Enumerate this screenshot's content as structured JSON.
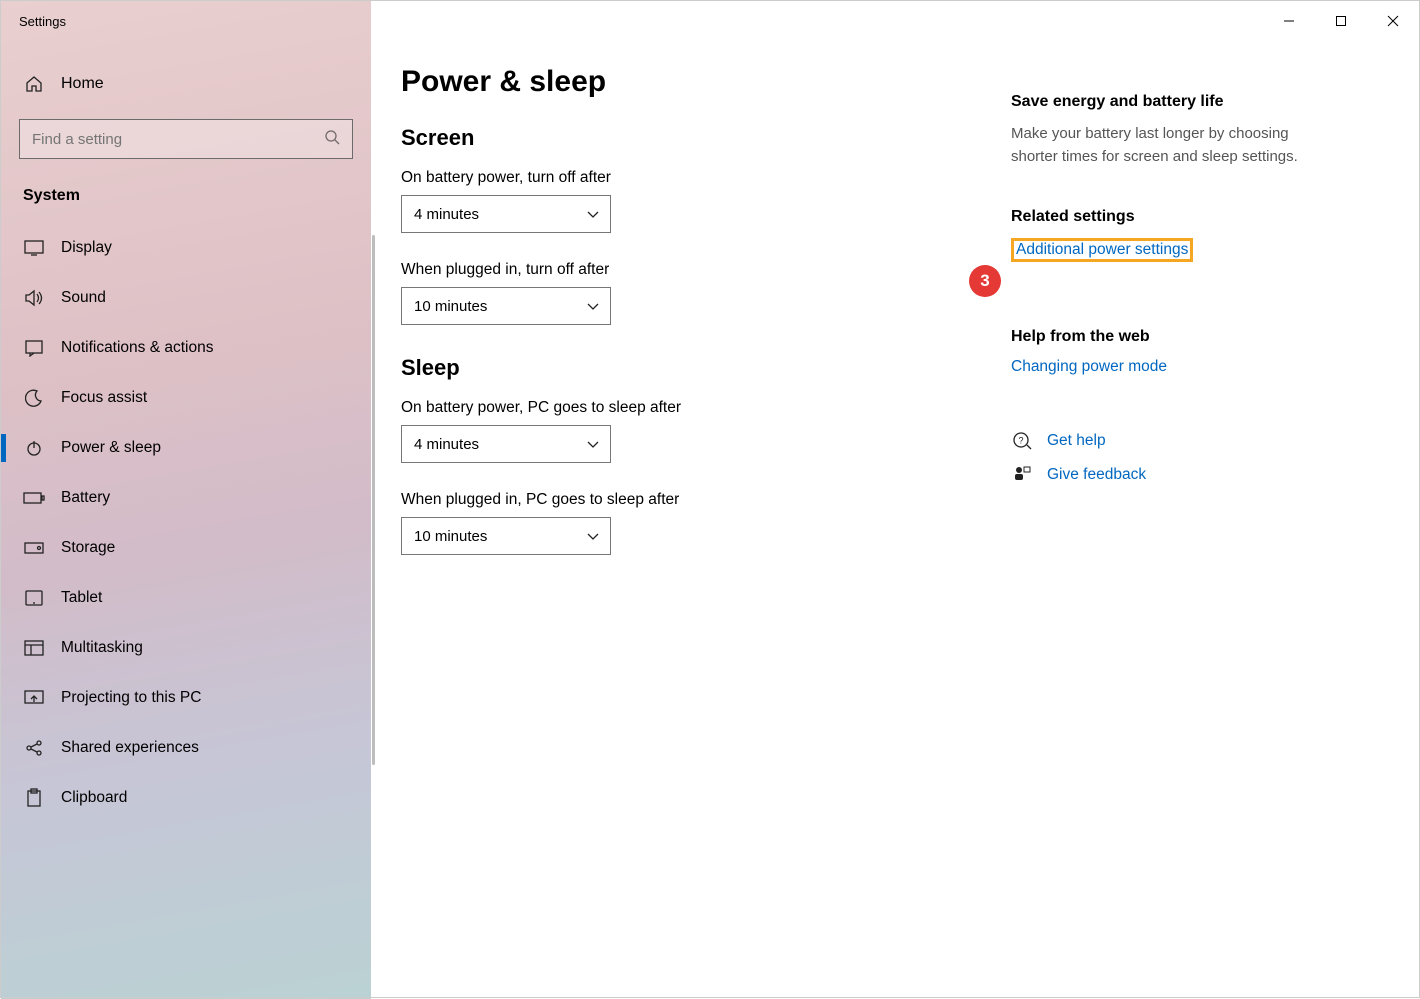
{
  "window": {
    "title": "Settings"
  },
  "sidebar": {
    "home": "Home",
    "search_placeholder": "Find a setting",
    "section": "System",
    "items": [
      {
        "label": "Display",
        "icon": "display"
      },
      {
        "label": "Sound",
        "icon": "sound"
      },
      {
        "label": "Notifications & actions",
        "icon": "notifications"
      },
      {
        "label": "Focus assist",
        "icon": "moon"
      },
      {
        "label": "Power & sleep",
        "icon": "power",
        "active": true
      },
      {
        "label": "Battery",
        "icon": "battery"
      },
      {
        "label": "Storage",
        "icon": "storage"
      },
      {
        "label": "Tablet",
        "icon": "tablet"
      },
      {
        "label": "Multitasking",
        "icon": "multitask"
      },
      {
        "label": "Projecting to this PC",
        "icon": "project"
      },
      {
        "label": "Shared experiences",
        "icon": "shared"
      },
      {
        "label": "Clipboard",
        "icon": "clipboard"
      }
    ]
  },
  "page": {
    "title": "Power & sleep",
    "screen": {
      "heading": "Screen",
      "battery_label": "On battery power, turn off after",
      "battery_value": "4 minutes",
      "plugged_label": "When plugged in, turn off after",
      "plugged_value": "10 minutes"
    },
    "sleep": {
      "heading": "Sleep",
      "battery_label": "On battery power, PC goes to sleep after",
      "battery_value": "4 minutes",
      "plugged_label": "When plugged in, PC goes to sleep after",
      "plugged_value": "10 minutes"
    }
  },
  "aside": {
    "energy_heading": "Save energy and battery life",
    "energy_text": "Make your battery last longer by choosing shorter times for screen and sleep settings.",
    "related_heading": "Related settings",
    "related_link": "Additional power settings",
    "help_heading": "Help from the web",
    "help_link": "Changing power mode",
    "get_help": "Get help",
    "feedback": "Give feedback"
  },
  "annotation": {
    "badge_3": "3"
  }
}
